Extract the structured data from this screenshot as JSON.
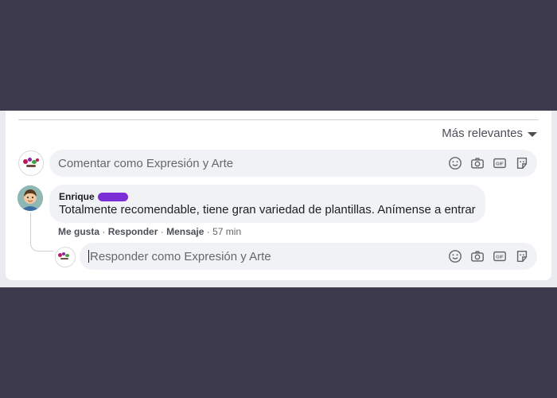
{
  "sort": {
    "label": "Más relevantes"
  },
  "composer": {
    "placeholder": "Comentar como Expresión y Arte"
  },
  "comment": {
    "author": "Enrique",
    "text": "Totalmente recomendable, tiene gran variedad de plantillas. Anímense a entrar",
    "actions": {
      "like": "Me gusta",
      "reply": "Responder",
      "message": "Mensaje",
      "time": "57 min",
      "separator": "·"
    }
  },
  "reply_composer": {
    "placeholder": "Responder como Expresión y Arte"
  },
  "composer_icons": [
    "emoji-icon",
    "camera-icon",
    "gif-icon",
    "sticker-icon"
  ],
  "colors": {
    "background": "#3d3a4d",
    "card": "#ffffff",
    "input": "#f0f2f5",
    "redaction": "#7b2fd6",
    "muted_text": "#65676b"
  }
}
